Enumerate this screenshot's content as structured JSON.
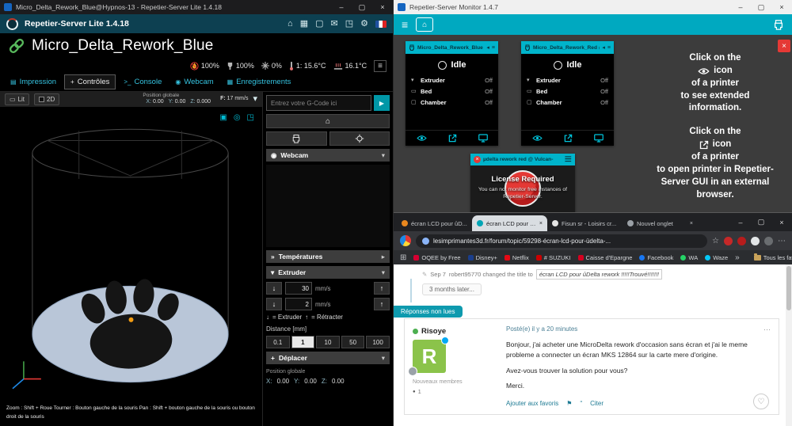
{
  "accents": {
    "teal": "#00a9c0",
    "cyan": "#00bcd4",
    "green": "#58b85c",
    "red": "#e53935"
  },
  "icons": {
    "minimize": "–",
    "maximize": "▢",
    "close": "×",
    "home": "⌂",
    "mail": "✉",
    "gear": "⚙",
    "menu": "≡",
    "apps": "⊞",
    "more_h": "⋯",
    "send": "▶",
    "up": "↑",
    "down": "↓",
    "chev_down": "▾",
    "chev_right": "▸",
    "star": "☆",
    "heart": "♡",
    "quote": "“",
    "flag": "⚑",
    "pencil": "✎",
    "dot": "●",
    "back_tri": "◂",
    "cube": "▣",
    "target": "◎",
    "frame": "◳",
    "list": "▤",
    "grid": "▦",
    "record": "◉",
    "console": ">_",
    "plus": "+",
    "chevrons": "»",
    "bed": "▭",
    "expand": "◳"
  },
  "left": {
    "title": "Micro_Delta_Rework_Blue@Hypnos-13 - Repetier-Server Lite 1.4.18",
    "brand": "Repetier-Server Lite 1.4.18",
    "printer_name": "Micro_Delta_Rework_Blue",
    "status": {
      "flow": "100%",
      "speed": "100%",
      "fan": "0%",
      "ext_temp": "1: 15.6°C",
      "bed_temp": "16.1°C"
    },
    "tabs": [
      {
        "label": "Impression"
      },
      {
        "label": "Contrôles"
      },
      {
        "label": "Console"
      },
      {
        "label": "Webcam"
      },
      {
        "label": "Enregistrements"
      }
    ],
    "viewport": {
      "bed": "Lit",
      "mode2d": "2D",
      "pos_label": "Position globale",
      "x_label": "X:",
      "x": "0.00",
      "y_label": "Y:",
      "y": "0.00",
      "z_label": "Z:",
      "z": "0.000",
      "f_label": "F:",
      "f_value": "17 mm/s",
      "help": "Zoom : Shift + Roue Tourner : Bouton gauche de la souris Pan : Shift + bouton gauche de la souris ou bouton droit de la souris"
    },
    "panel": {
      "gcode_placeholder": "Entrez votre G-Code ici",
      "webcam": "Webcam",
      "temperatures": "Températures",
      "extruder": "Extruder",
      "deplacer": "Déplacer",
      "speed1": "30",
      "unit1": "mm/s",
      "speed2": "2",
      "unit2": "mm/s",
      "legend1": "= Extruder",
      "legend2": "= Rétracter",
      "distance_label": "Distance [mm]",
      "distances": [
        "0.1",
        "1",
        "10",
        "50",
        "100"
      ],
      "pos_label": "Position globale",
      "x_label": "X:",
      "x": "0.00",
      "y_label": "Y:",
      "y": "0.00",
      "z_label": "Z:",
      "z": "0.00"
    }
  },
  "monitor": {
    "title": "Repetier-Server Monitor 1.4.7",
    "cards": [
      {
        "name": "Micro_Delta_Rework_Blue @",
        "state": "Idle",
        "rows": [
          {
            "label": "Extruder",
            "value": "Off"
          },
          {
            "label": "Bed",
            "value": "Off"
          },
          {
            "label": "Chamber",
            "value": "Off"
          }
        ]
      },
      {
        "name": "Micro_Delta_Rework_Red @",
        "state": "Idle",
        "rows": [
          {
            "label": "Extruder",
            "value": "Off"
          },
          {
            "label": "Bed",
            "value": "Off"
          },
          {
            "label": "Chamber",
            "value": "Off"
          }
        ]
      }
    ],
    "license": {
      "name": "µdelta rework red @ Vulcan-",
      "title": "License Required",
      "message": "You can not monitor free instances of Repetier-Server."
    },
    "help1": {
      "l1": "Click on the",
      "l2": "icon",
      "l3": "of a printer",
      "l4": "to see extended",
      "l5": "information."
    },
    "help2": {
      "l1": "Click on the",
      "l2": "icon",
      "l3": "of a printer",
      "l4": "to open printer in Repetier-",
      "l5": "Server GUI in an external",
      "l6": "browser."
    }
  },
  "browser": {
    "tabs": [
      {
        "label": "écran LCD pour ûD..."
      },
      {
        "label": "écran LCD pour ûDe..."
      },
      {
        "label": "Fisun sr - Loisirs cr..."
      },
      {
        "label": "Nouvel onglet"
      }
    ],
    "url": "lesimprimantes3d.fr/forum/topic/59298-écran-lcd-pour-üdelta-...",
    "bookmarks": [
      "OQEE by Free",
      "Disney+",
      "Netflix",
      "# SUZUKI",
      "Caisse d'Epargne",
      "Facebook",
      "WA",
      "Waze"
    ],
    "bookmarks_more": "Tous les favoris",
    "forum": {
      "change_date": "Sep 7",
      "change_text": "robert95770 changed the title to",
      "change_title": "écran LCD pour ûDelta rework !!!!!Trouvé!!!!!!!",
      "gap": "3 months later...",
      "unread": "Réponses non lues",
      "author": "Risoye",
      "posted": "Posté(e) il y a 20 minutes",
      "avatar_letter": "R",
      "group": "Nouveaux membres",
      "count": "1",
      "p1": "Bonjour, j'ai acheter une MicroDelta rework d'occasion sans écran et j'ai le meme probleme a connecter un écran MKS 12864 sur la carte mere d'origine.",
      "p2": "Avez-vous trouver la solution pour vous?",
      "p3": "Merci.",
      "fav": "Ajouter aux favoris",
      "quote": "Citer"
    }
  }
}
